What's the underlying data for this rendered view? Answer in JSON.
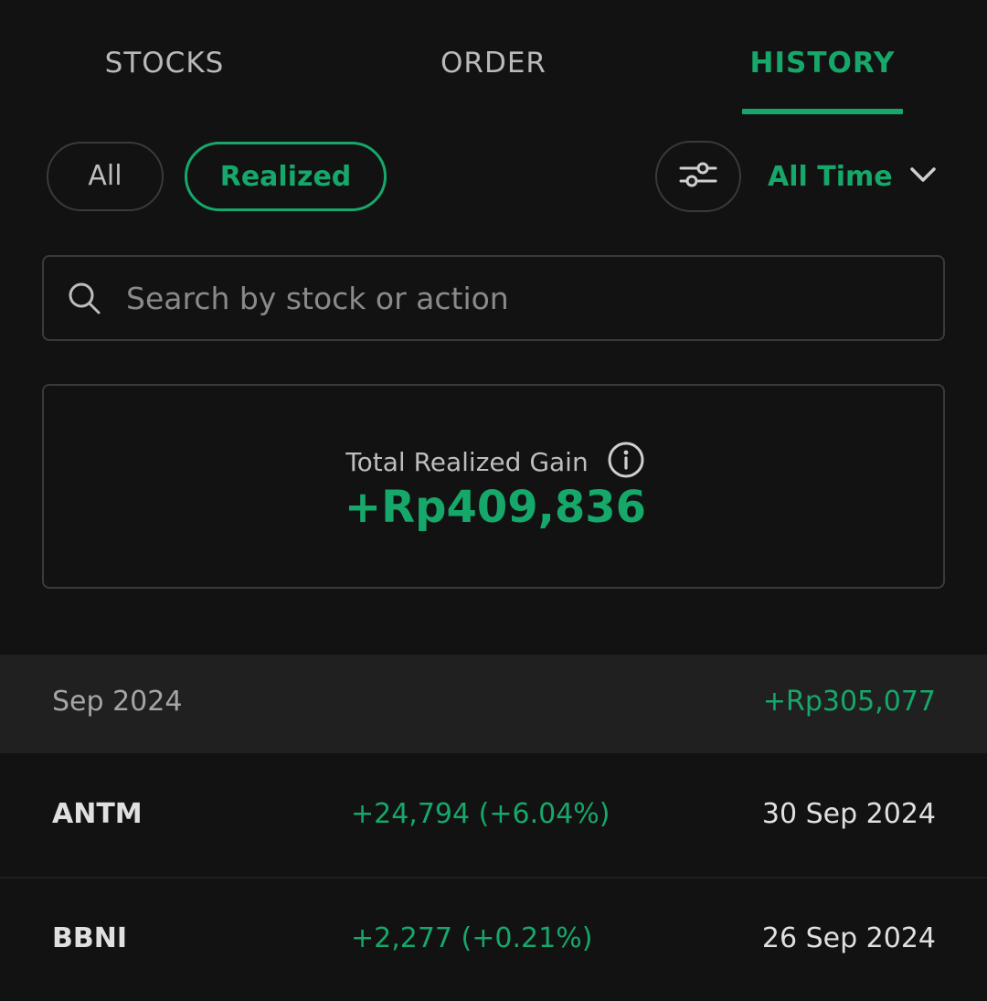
{
  "tabs": [
    {
      "label": "STOCKS",
      "active": false
    },
    {
      "label": "ORDER",
      "active": false
    },
    {
      "label": "HISTORY",
      "active": true
    }
  ],
  "filters": {
    "all_label": "All",
    "realized_label": "Realized",
    "selected": "Realized",
    "filter_icon": "sliders-icon",
    "time_range": "All Time",
    "time_range_icon": "chevron-down-icon"
  },
  "search": {
    "placeholder": "Search by stock or action",
    "value": "",
    "icon": "search-icon"
  },
  "summary": {
    "label": "Total Realized Gain",
    "info_icon": "info-icon",
    "value": "+Rp409,836"
  },
  "history": {
    "month": "Sep 2024",
    "month_total": "+Rp305,077",
    "rows": [
      {
        "ticker": "ANTM",
        "gain": "+24,794 (+6.04%)",
        "date": "30 Sep 2024"
      },
      {
        "ticker": "BBNI",
        "gain": "+2,277 (+0.21%)",
        "date": "26 Sep 2024"
      }
    ]
  },
  "colors": {
    "accent": "#16a86a",
    "background": "#121212",
    "border": "#3a3a3a",
    "month_row_bg": "#202020"
  }
}
